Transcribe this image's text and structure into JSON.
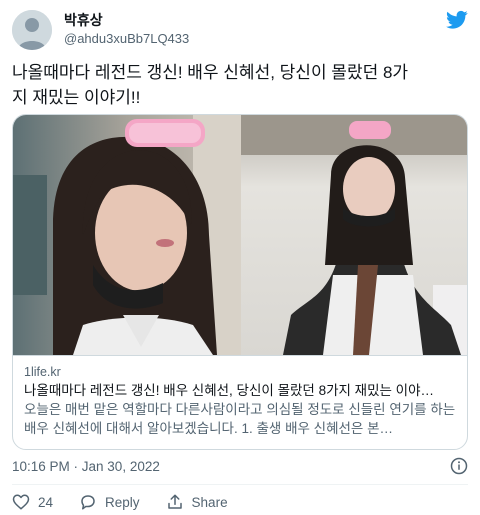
{
  "author": {
    "name": "박휴상",
    "handle": "@ahdu3xuBb7LQ433"
  },
  "tweet": {
    "text_line1": "나올때마다 레전드 갱신! 배우 신혜선, 당신이 몰랐던 8가",
    "text_line2": "지 재밌는 이야기!!"
  },
  "card": {
    "domain": "1life.kr",
    "title": "나올때마다 레전드 갱신! 배우 신혜선, 당신이 몰랐던 8가지 재밌는 이야…",
    "description": "오늘은 매번 맡은 역할마다 다른사람이라고 의심될 정도로 신들린 연기를 하는 배우 신혜선에 대해서 알아보겠습니다. 1. 출생 배우 신혜선은 본…"
  },
  "timestamp": "10:16 PM · Jan 30, 2022",
  "actions": {
    "like_count": "24",
    "reply_label": "Reply",
    "share_label": "Share"
  },
  "icons": [
    "twitter-bird-icon",
    "info-icon",
    "heart-icon",
    "reply-bubble-icon",
    "share-icon"
  ],
  "colors": {
    "brand": "#1d9bf0",
    "text": "#0f1419",
    "secondary": "#536471",
    "border": "#cfd9de"
  }
}
